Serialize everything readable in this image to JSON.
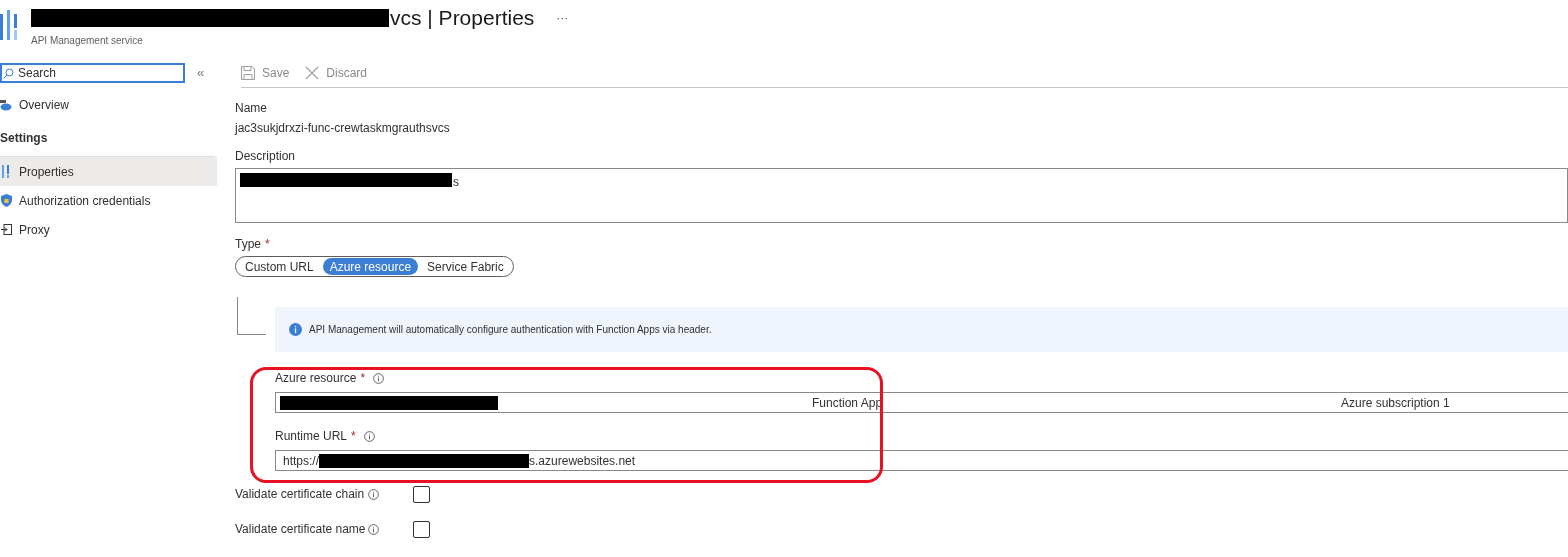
{
  "header": {
    "title": "vcs | Properties",
    "subtitle": "API Management service",
    "more": "···"
  },
  "sidebar": {
    "search": {
      "placeholder": "Search"
    },
    "collapse": "«",
    "items": [
      {
        "kind": "item",
        "label": "Overview",
        "selected": false
      },
      {
        "kind": "heading",
        "label": "Settings",
        "selected": false
      },
      {
        "kind": "item",
        "label": "Properties",
        "selected": true
      },
      {
        "kind": "item",
        "label": "Authorization credentials",
        "selected": false
      },
      {
        "kind": "item",
        "label": "Proxy",
        "selected": false
      }
    ]
  },
  "toolbar": [
    {
      "kind": "save",
      "label": "Save",
      "disabled": true
    },
    {
      "kind": "discard",
      "label": "Discard",
      "disabled": true
    }
  ],
  "form": {
    "name": {
      "label": "Name",
      "value": "jac3sukjdrxzi-func-crewtaskmgrauthsvcs"
    },
    "description": {
      "label": "Description",
      "value": "s"
    },
    "type": {
      "label": "Type",
      "required_mark": "*",
      "options": [
        {
          "label": "Custom URL",
          "selected": false
        },
        {
          "label": "Azure resource",
          "selected": true
        },
        {
          "label": "Service Fabric",
          "selected": false
        }
      ]
    },
    "info": "API Management will automatically configure authentication with Function Apps via header.",
    "azure_resource": {
      "label": "Azure resource",
      "required_mark": "*",
      "kind_text": "Function App",
      "subscription": "Azure subscription 1"
    },
    "runtime_url": {
      "label": "Runtime URL",
      "required_mark": "*",
      "prefix": "https://",
      "suffix": "s.azurewebsites.net"
    },
    "checks": [
      {
        "label": "Validate certificate chain",
        "checked": false
      },
      {
        "label": "Validate certificate name",
        "checked": false
      }
    ]
  }
}
